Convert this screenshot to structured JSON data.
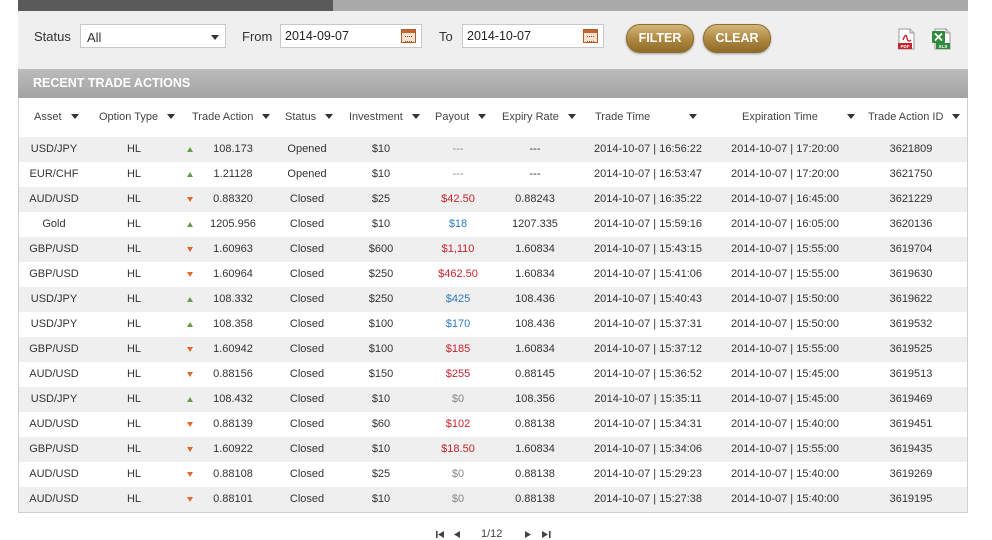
{
  "filters": {
    "status_label": "Status",
    "status_value": "All",
    "from_label": "From",
    "from_value": "2014-09-07",
    "to_label": "To",
    "to_value": "2014-10-07",
    "filter_button": "FILTER",
    "clear_button": "CLEAR",
    "export_pdf_icon": "pdf-file-icon",
    "export_xls_icon": "xls-file-icon"
  },
  "section_title": "RECENT TRADE ACTIONS",
  "columns": [
    "Asset",
    "Option Type",
    "Trade Action",
    "Status",
    "Investment",
    "Payout",
    "Expiry Rate",
    "Trade Time",
    "Expiration Time",
    "Trade Action ID"
  ],
  "colors": {
    "loss": "#c8232c",
    "win": "#2e7bbf",
    "neutral": "#888888",
    "up_arrow": "#6a9a4a",
    "down_arrow": "#e0682a",
    "button_gold": "#b08a43"
  },
  "rows": [
    {
      "asset": "USD/JPY",
      "type": "HL",
      "dir": "up",
      "rate": "108.173",
      "status": "Opened",
      "investment": "$10",
      "payout": "---",
      "payout_kind": "neutral",
      "expiry_rate": "---",
      "trade_time": "2014-10-07 | 16:56:22",
      "expiration_time": "2014-10-07 | 17:20:00",
      "id": "3621809"
    },
    {
      "asset": "EUR/CHF",
      "type": "HL",
      "dir": "up",
      "rate": "1.21128",
      "status": "Opened",
      "investment": "$10",
      "payout": "---",
      "payout_kind": "neutral",
      "expiry_rate": "---",
      "trade_time": "2014-10-07 | 16:53:47",
      "expiration_time": "2014-10-07 | 17:20:00",
      "id": "3621750"
    },
    {
      "asset": "AUD/USD",
      "type": "HL",
      "dir": "down",
      "rate": "0.88320",
      "status": "Closed",
      "investment": "$25",
      "payout": "$42.50",
      "payout_kind": "loss",
      "expiry_rate": "0.88243",
      "trade_time": "2014-10-07 | 16:35:22",
      "expiration_time": "2014-10-07 | 16:45:00",
      "id": "3621229"
    },
    {
      "asset": "Gold",
      "type": "HL",
      "dir": "up",
      "rate": "1205.956",
      "status": "Closed",
      "investment": "$10",
      "payout": "$18",
      "payout_kind": "win",
      "expiry_rate": "1207.335",
      "trade_time": "2014-10-07 | 15:59:16",
      "expiration_time": "2014-10-07 | 16:05:00",
      "id": "3620136"
    },
    {
      "asset": "GBP/USD",
      "type": "HL",
      "dir": "down",
      "rate": "1.60963",
      "status": "Closed",
      "investment": "$600",
      "payout": "$1,110",
      "payout_kind": "loss",
      "expiry_rate": "1.60834",
      "trade_time": "2014-10-07 | 15:43:15",
      "expiration_time": "2014-10-07 | 15:55:00",
      "id": "3619704"
    },
    {
      "asset": "GBP/USD",
      "type": "HL",
      "dir": "down",
      "rate": "1.60964",
      "status": "Closed",
      "investment": "$250",
      "payout": "$462.50",
      "payout_kind": "loss",
      "expiry_rate": "1.60834",
      "trade_time": "2014-10-07 | 15:41:06",
      "expiration_time": "2014-10-07 | 15:55:00",
      "id": "3619630"
    },
    {
      "asset": "USD/JPY",
      "type": "HL",
      "dir": "up",
      "rate": "108.332",
      "status": "Closed",
      "investment": "$250",
      "payout": "$425",
      "payout_kind": "win",
      "expiry_rate": "108.436",
      "trade_time": "2014-10-07 | 15:40:43",
      "expiration_time": "2014-10-07 | 15:50:00",
      "id": "3619622"
    },
    {
      "asset": "USD/JPY",
      "type": "HL",
      "dir": "up",
      "rate": "108.358",
      "status": "Closed",
      "investment": "$100",
      "payout": "$170",
      "payout_kind": "win",
      "expiry_rate": "108.436",
      "trade_time": "2014-10-07 | 15:37:31",
      "expiration_time": "2014-10-07 | 15:50:00",
      "id": "3619532"
    },
    {
      "asset": "GBP/USD",
      "type": "HL",
      "dir": "down",
      "rate": "1.60942",
      "status": "Closed",
      "investment": "$100",
      "payout": "$185",
      "payout_kind": "loss",
      "expiry_rate": "1.60834",
      "trade_time": "2014-10-07 | 15:37:12",
      "expiration_time": "2014-10-07 | 15:55:00",
      "id": "3619525"
    },
    {
      "asset": "AUD/USD",
      "type": "HL",
      "dir": "down",
      "rate": "0.88156",
      "status": "Closed",
      "investment": "$150",
      "payout": "$255",
      "payout_kind": "loss",
      "expiry_rate": "0.88145",
      "trade_time": "2014-10-07 | 15:36:52",
      "expiration_time": "2014-10-07 | 15:45:00",
      "id": "3619513"
    },
    {
      "asset": "USD/JPY",
      "type": "HL",
      "dir": "up",
      "rate": "108.432",
      "status": "Closed",
      "investment": "$10",
      "payout": "$0",
      "payout_kind": "neutral",
      "expiry_rate": "108.356",
      "trade_time": "2014-10-07 | 15:35:11",
      "expiration_time": "2014-10-07 | 15:45:00",
      "id": "3619469"
    },
    {
      "asset": "AUD/USD",
      "type": "HL",
      "dir": "down",
      "rate": "0.88139",
      "status": "Closed",
      "investment": "$60",
      "payout": "$102",
      "payout_kind": "loss",
      "expiry_rate": "0.88138",
      "trade_time": "2014-10-07 | 15:34:31",
      "expiration_time": "2014-10-07 | 15:40:00",
      "id": "3619451"
    },
    {
      "asset": "GBP/USD",
      "type": "HL",
      "dir": "down",
      "rate": "1.60922",
      "status": "Closed",
      "investment": "$10",
      "payout": "$18.50",
      "payout_kind": "loss",
      "expiry_rate": "1.60834",
      "trade_time": "2014-10-07 | 15:34:06",
      "expiration_time": "2014-10-07 | 15:55:00",
      "id": "3619435"
    },
    {
      "asset": "AUD/USD",
      "type": "HL",
      "dir": "down",
      "rate": "0.88108",
      "status": "Closed",
      "investment": "$25",
      "payout": "$0",
      "payout_kind": "neutral",
      "expiry_rate": "0.88138",
      "trade_time": "2014-10-07 | 15:29:23",
      "expiration_time": "2014-10-07 | 15:40:00",
      "id": "3619269"
    },
    {
      "asset": "AUD/USD",
      "type": "HL",
      "dir": "down",
      "rate": "0.88101",
      "status": "Closed",
      "investment": "$10",
      "payout": "$0",
      "payout_kind": "neutral",
      "expiry_rate": "0.88138",
      "trade_time": "2014-10-07 | 15:27:38",
      "expiration_time": "2014-10-07 | 15:40:00",
      "id": "3619195"
    }
  ],
  "pagination": {
    "page_text": "1/12",
    "first_icon": "first-page-icon",
    "prev_icon": "prev-page-icon",
    "next_icon": "next-page-icon",
    "last_icon": "last-page-icon"
  }
}
